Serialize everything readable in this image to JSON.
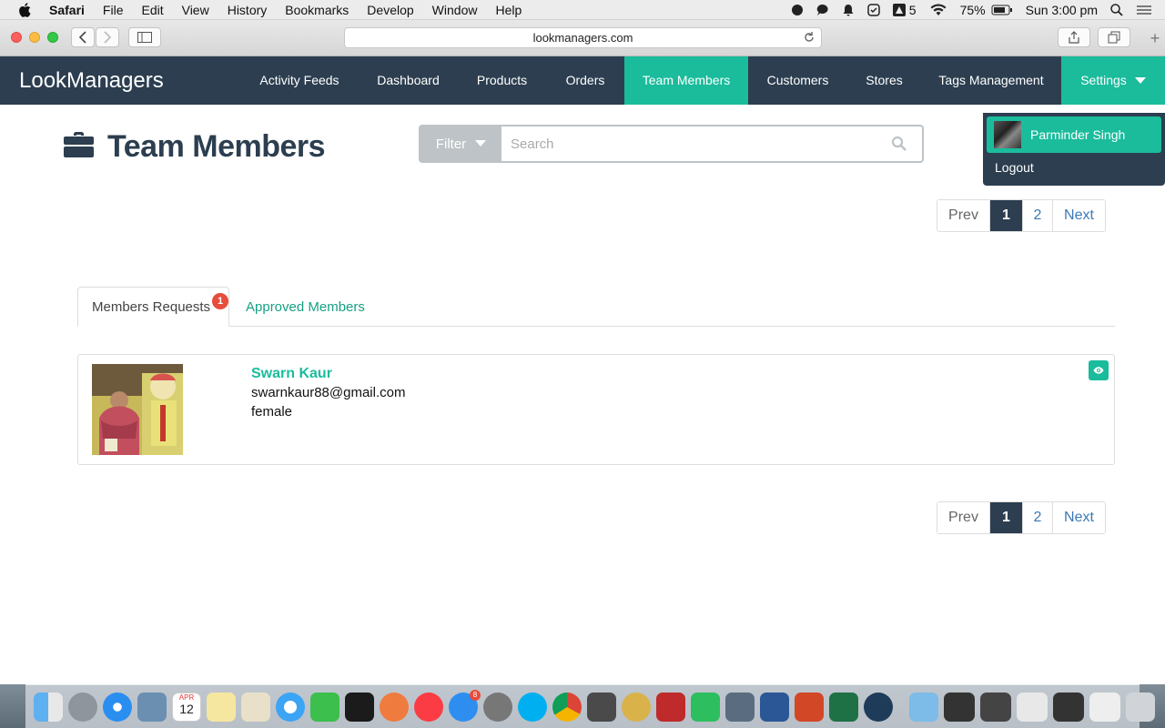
{
  "menubar": {
    "app_name": "Safari",
    "items": [
      "File",
      "Edit",
      "View",
      "History",
      "Bookmarks",
      "Develop",
      "Window",
      "Help"
    ],
    "adobe_count": "5",
    "battery": "75%",
    "clock": "Sun 3:00 pm"
  },
  "browser": {
    "url": "lookmanagers.com"
  },
  "navbar": {
    "brand": "LookManagers",
    "items": [
      "Activity Feeds",
      "Dashboard",
      "Products",
      "Orders",
      "Team Members",
      "Customers",
      "Stores",
      "Tags Management"
    ],
    "active_item": "Team Members",
    "settings_label": "Settings"
  },
  "user_menu": {
    "name": "Parminder Singh",
    "logout_label": "Logout"
  },
  "page": {
    "title": "Team Members",
    "filter_label": "Filter",
    "search_placeholder": "Search"
  },
  "pagination": {
    "prev_label": "Prev",
    "pages": [
      "1",
      "2"
    ],
    "current_page": "1",
    "next_label": "Next"
  },
  "tabs": {
    "requests_label": "Members Requests",
    "requests_badge": "1",
    "approved_label": "Approved Members",
    "active": "Members Requests"
  },
  "members": [
    {
      "name": "Swarn Kaur",
      "email": "swarnkaur88@gmail.com",
      "gender": "female"
    }
  ],
  "dock": {
    "calendar_month": "APR",
    "calendar_day": "12",
    "appstore_badge": "8"
  },
  "colors": {
    "navbar_bg": "#2c3e50",
    "accent": "#1abc9c",
    "badge": "#e74c3c",
    "link": "#3b7ab5"
  }
}
